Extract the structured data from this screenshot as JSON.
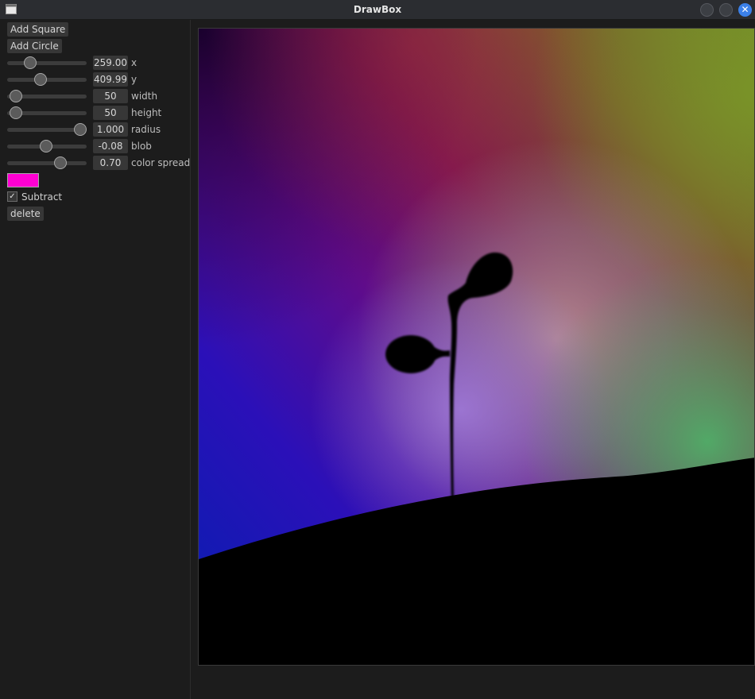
{
  "window": {
    "title": "DrawBox",
    "icon": "app-window-icon",
    "close_glyph": "✕"
  },
  "panel": {
    "add_square_label": "Add Square",
    "add_circle_label": "Add Circle",
    "sliders": [
      {
        "label": "x",
        "value": "259.00",
        "fraction": 0.29
      },
      {
        "label": "y",
        "value": "409.99",
        "fraction": 0.42
      },
      {
        "label": "width",
        "value": "50",
        "fraction": 0.11
      },
      {
        "label": "height",
        "value": "50",
        "fraction": 0.11
      },
      {
        "label": "radius",
        "value": "1.000",
        "fraction": 0.92
      },
      {
        "label": "blob",
        "value": "-0.08",
        "fraction": 0.49
      },
      {
        "label": "color spread",
        "value": "0.70",
        "fraction": 0.67
      }
    ],
    "color": "#ff00d2",
    "subtract": {
      "label": "Subtract",
      "checked": true,
      "check_glyph": "✓"
    },
    "delete_label": "delete"
  },
  "colors": {
    "titlebar": "#2b2d31",
    "accent_close": "#3b80e8",
    "panel_bg": "#1c1c1c"
  }
}
